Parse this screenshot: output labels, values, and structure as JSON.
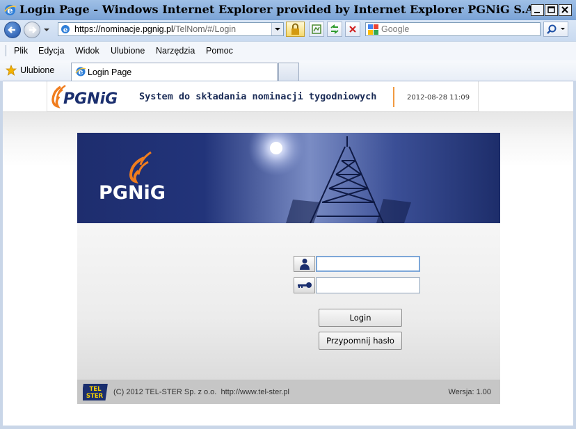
{
  "window": {
    "title": "Login Page - Windows Internet Explorer provided by Internet Explorer PGNiG S.A.",
    "controls": [
      "minimize-icon",
      "maximize-icon",
      "close-icon"
    ]
  },
  "navigation": {
    "address_host": "https://nominacje.pgnig.pl",
    "address_path": "/TelNom/#/Login",
    "search_placeholder": "Google"
  },
  "menu": {
    "items": [
      "Plik",
      "Edycja",
      "Widok",
      "Ulubione",
      "Narzędzia",
      "Pomoc"
    ]
  },
  "favorites": {
    "label": "Ulubione"
  },
  "tab": {
    "label": "Login Page"
  },
  "header": {
    "logo_text": "PGNiG",
    "title": "System do składania nominacji tygodniowych",
    "datetime": "2012-08-28 11:09"
  },
  "banner": {
    "logo_text": "PGNiG"
  },
  "login_form": {
    "username_value": "",
    "password_value": "",
    "login_label": "Login",
    "remind_label": "Przypomnij hasło"
  },
  "footer": {
    "logo_line1": "TEL",
    "logo_line2": "STER",
    "copyright": "(C) 2012 TEL-STER Sp. z o.o.",
    "url": "http://www.tel-ster.pl",
    "version": "Wersja: 1.00"
  },
  "colors": {
    "brand_orange": "#f07d1e",
    "brand_navy": "#1a2e6e",
    "banner_blue": "#25377a"
  }
}
